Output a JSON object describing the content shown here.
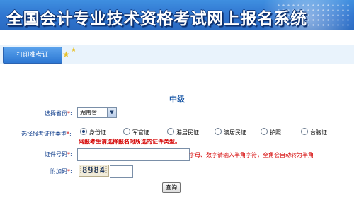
{
  "header": {
    "title": "全国会计专业技术资格考试网上报名系统"
  },
  "nav": {
    "print_tab_label": "打印准考证",
    "star_icons": [
      "star-icon",
      "star-icon"
    ]
  },
  "form": {
    "level_heading": "中级",
    "province": {
      "label": "选择省份",
      "required_mark": "*",
      "selected_value": "湖南省"
    },
    "id_type": {
      "label": "选择报考证件类型",
      "required_mark": "*",
      "options": [
        {
          "label": "身份证",
          "selected": true
        },
        {
          "label": "军官证",
          "selected": false
        },
        {
          "label": "港居民证",
          "selected": false
        },
        {
          "label": "澳居民证",
          "selected": false
        },
        {
          "label": "护照",
          "selected": false
        },
        {
          "label": "台胞证",
          "selected": false
        }
      ],
      "warning": "网报考生请选择报名时所选的证件类型。"
    },
    "id_number": {
      "label": "证件号码",
      "required_mark": "*",
      "value": "",
      "hint": "字母、数字请输入半角字符，全角会自动转为半角"
    },
    "captcha": {
      "label": "附加码",
      "required_mark": "*",
      "code": "8984",
      "value": ""
    },
    "submit_label": "查询"
  },
  "colors": {
    "banner": "#2f74cf",
    "label_text": "#15428f",
    "warning_text": "#d40000",
    "heading_text": "#1d5aa8"
  }
}
